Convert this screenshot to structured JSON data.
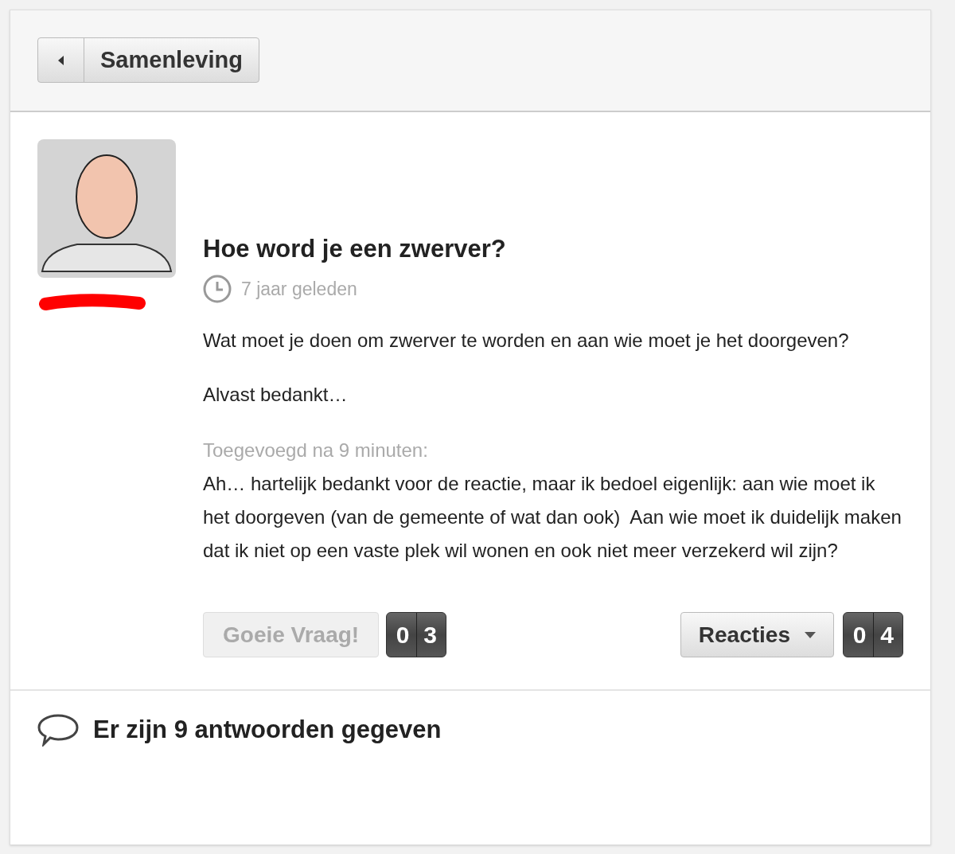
{
  "breadcrumb": {
    "label": "Samenleving"
  },
  "question": {
    "title": "Hoe word je een zwerver?",
    "time": "7 jaar geleden",
    "paragraphs": [
      "Wat moet je doen om zwerver te worden en aan wie moet je het doorgeven?",
      "Alvast bedankt…"
    ],
    "addition": {
      "label": "Toegevoegd na 9 minuten:",
      "text": "Ah… hartelijk bedankt voor de reactie, maar ik bedoel eigenlijk: aan wie moet ik het doorgeven (van de gemeente of wat dan ook)  Aan wie moet ik duidelijk maken dat ik niet op een vaste plek wil wonen en ook niet meer verzekerd wil zijn?"
    }
  },
  "vote": {
    "label": "Goeie Vraag!",
    "disabled": true,
    "digits": [
      "0",
      "3"
    ]
  },
  "comments": {
    "label": "Reacties",
    "digits": [
      "0",
      "4"
    ]
  },
  "answers": {
    "text": "Er zijn 9 antwoorden gegeven"
  }
}
